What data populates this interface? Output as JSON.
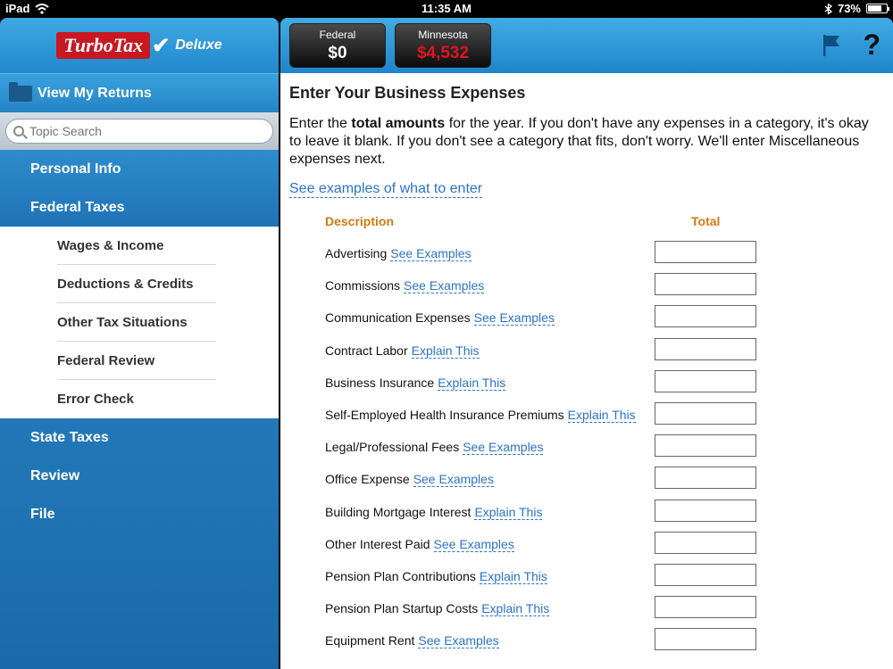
{
  "status": {
    "device": "iPad",
    "time": "11:35 AM",
    "battery": "73%",
    "battery_level": 0.73
  },
  "sidebar": {
    "logo": {
      "brand": "TurboTax",
      "edition": "Deluxe"
    },
    "view_returns": "View My Returns",
    "search_placeholder": "Topic Search",
    "nav_top": [
      {
        "label": "Personal Info"
      },
      {
        "label": "Federal Taxes"
      }
    ],
    "subnav": [
      {
        "label": "Wages & Income"
      },
      {
        "label": "Deductions & Credits"
      },
      {
        "label": "Other Tax Situations"
      },
      {
        "label": "Federal Review"
      },
      {
        "label": "Error Check"
      }
    ],
    "nav_bottom": [
      {
        "label": "State Taxes"
      },
      {
        "label": "Review"
      },
      {
        "label": "File"
      }
    ]
  },
  "header": {
    "federal": {
      "label": "Federal",
      "amount": "$0",
      "color": "#ffffff"
    },
    "state": {
      "label": "Minnesota",
      "amount": "$4,532",
      "color": "#e0141e"
    }
  },
  "main": {
    "title": "Enter Your Business Expenses",
    "intro_prefix": "Enter the ",
    "intro_bold": "total amounts",
    "intro_suffix": " for the year. If you don't have any expenses in a category, it's okay to leave it blank. If you don't see a category that fits, don't worry. We'll enter Miscellaneous expenses next.",
    "examples_link": "See examples of what to enter",
    "col_description": "Description",
    "col_total": "Total",
    "rows": [
      {
        "label": "Advertising",
        "link": "See Examples",
        "value": ""
      },
      {
        "label": "Commissions",
        "link": "See Examples",
        "value": ""
      },
      {
        "label": "Communication Expenses",
        "link": "See Examples",
        "value": ""
      },
      {
        "label": "Contract Labor",
        "link": "Explain This",
        "value": ""
      },
      {
        "label": "Business Insurance",
        "link": "Explain This",
        "value": ""
      },
      {
        "label": "Self-Employed Health Insurance Premiums",
        "link": "Explain This",
        "value": ""
      },
      {
        "label": "Legal/Professional Fees",
        "link": "See Examples",
        "value": ""
      },
      {
        "label": "Office Expense",
        "link": "See Examples",
        "value": ""
      },
      {
        "label": "Building Mortgage Interest",
        "link": "Explain This",
        "value": ""
      },
      {
        "label": "Other Interest Paid",
        "link": "See Examples",
        "value": ""
      },
      {
        "label": "Pension Plan Contributions",
        "link": "Explain This",
        "value": ""
      },
      {
        "label": "Pension Plan Startup Costs",
        "link": "Explain This",
        "value": ""
      },
      {
        "label": "Equipment Rent",
        "link": "See Examples",
        "value": ""
      }
    ]
  }
}
